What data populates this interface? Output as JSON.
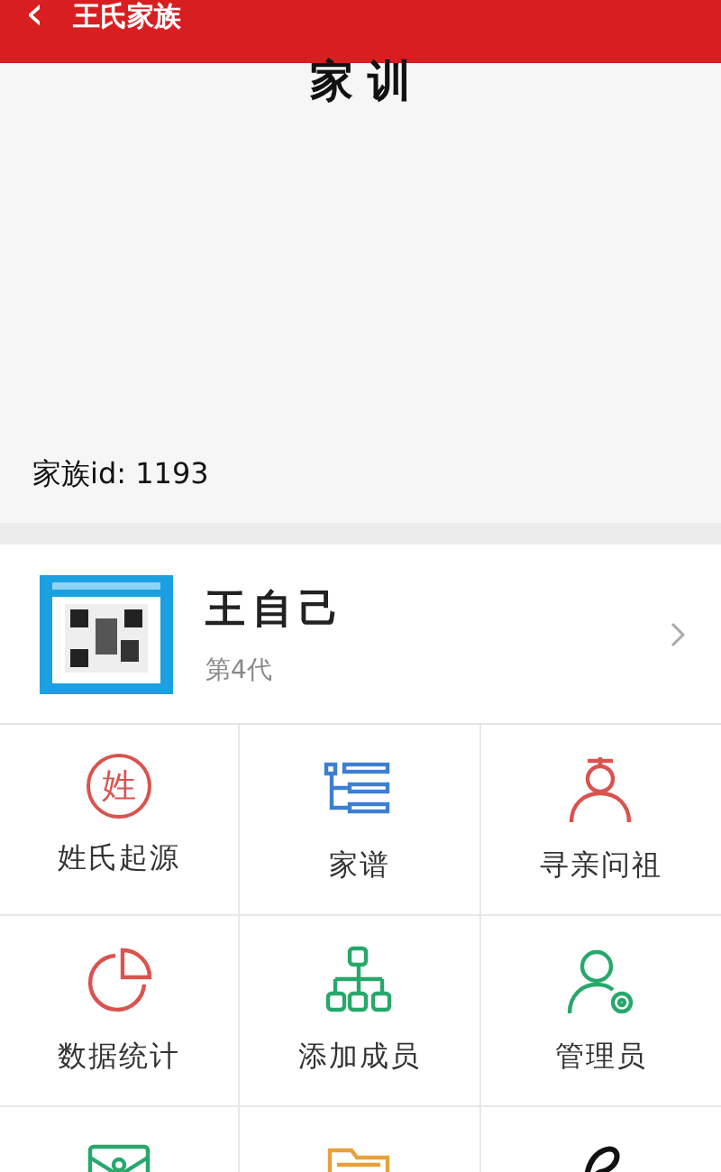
{
  "header": {
    "back_icon": "‹",
    "title": "王氏家族"
  },
  "motto": {
    "title": "家 训",
    "family_id": "家族id: 1193"
  },
  "profile": {
    "name": "王自己",
    "generation": "第4代"
  },
  "grid": [
    {
      "kind": "surname",
      "label": "姓氏起源",
      "glyph": "姓"
    },
    {
      "kind": "tree",
      "label": "家谱"
    },
    {
      "kind": "ancestor",
      "label": "寻亲问祖"
    },
    {
      "kind": "pie",
      "label": "数据统计"
    },
    {
      "kind": "org",
      "label": "添加成员"
    },
    {
      "kind": "admin",
      "label": "管理员"
    },
    {
      "kind": "envelope"
    },
    {
      "kind": "folder"
    },
    {
      "kind": "knot"
    }
  ]
}
